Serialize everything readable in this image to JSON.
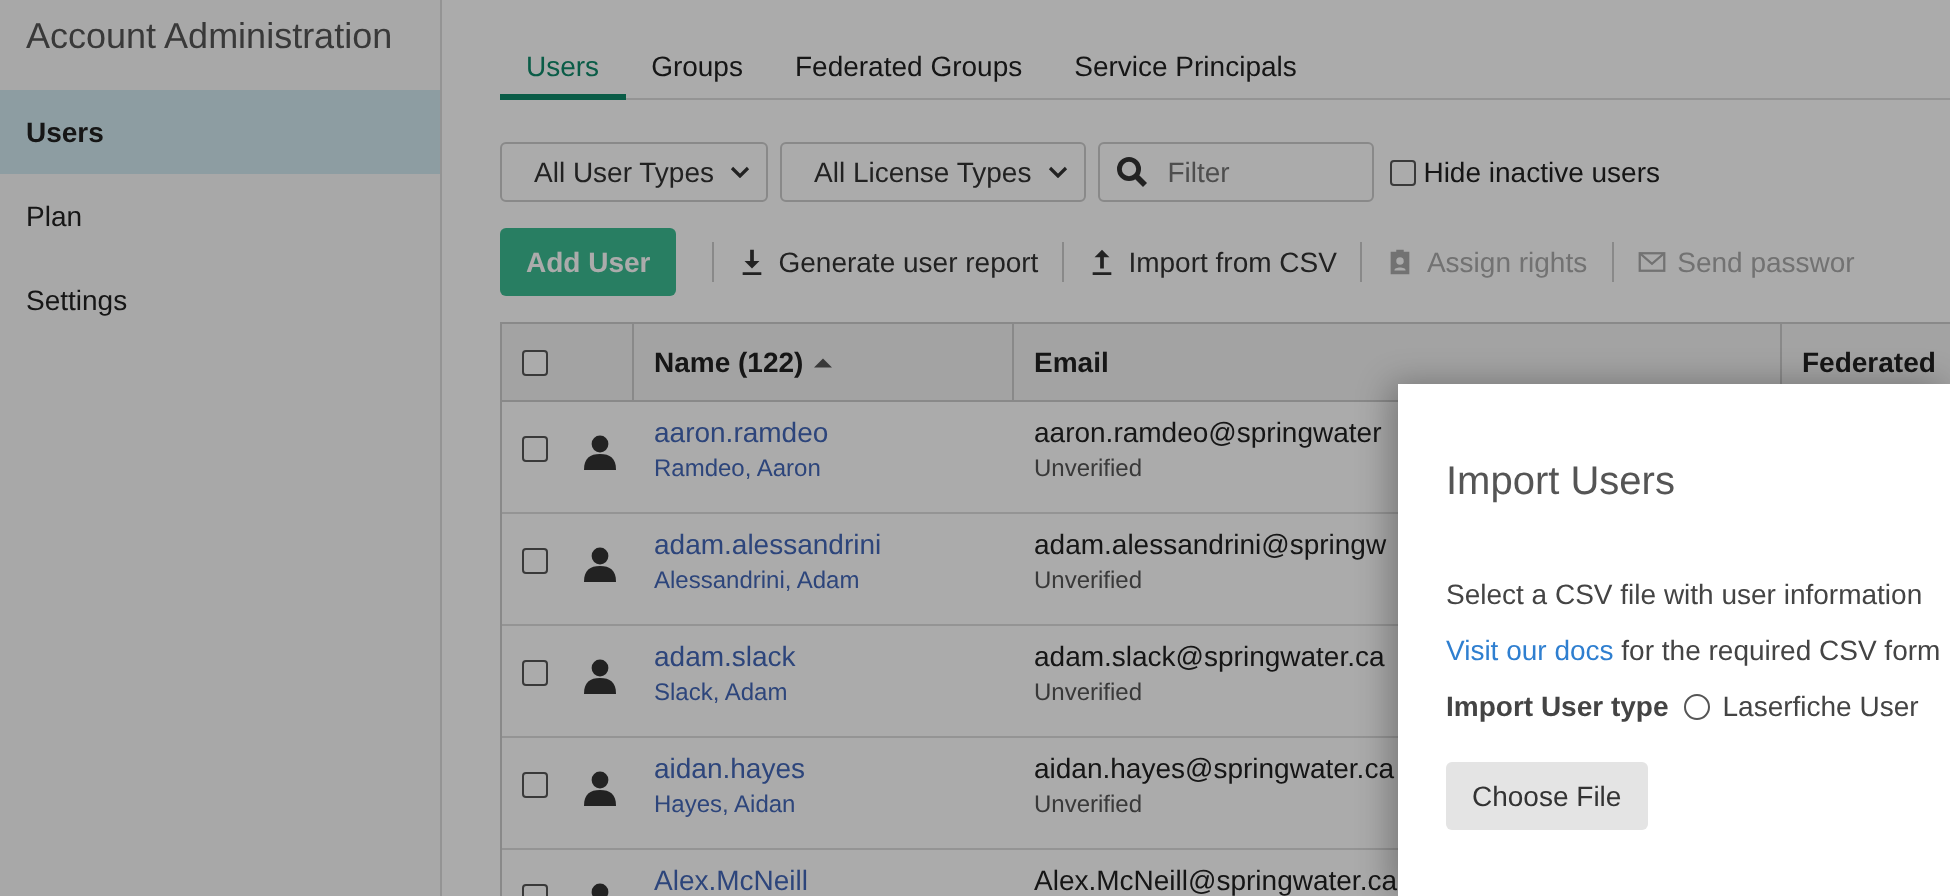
{
  "sidebar": {
    "title": "Account Administration",
    "items": [
      {
        "label": "Users",
        "selected": true
      },
      {
        "label": "Plan",
        "selected": false
      },
      {
        "label": "Settings",
        "selected": false
      }
    ]
  },
  "tabs": [
    {
      "label": "Users",
      "selected": true
    },
    {
      "label": "Groups",
      "selected": false
    },
    {
      "label": "Federated Groups",
      "selected": false
    },
    {
      "label": "Service Principals",
      "selected": false
    }
  ],
  "filters": {
    "user_type": "All User Types",
    "license_type": "All License Types",
    "search": {
      "placeholder": "Filter"
    },
    "hide_inactive": {
      "label": "Hide inactive users",
      "checked": false
    }
  },
  "toolbar": {
    "add_button": "Add User",
    "actions": [
      {
        "kind": "download",
        "label": "Generate user report",
        "disabled": false
      },
      {
        "kind": "upload",
        "label": "Import from CSV",
        "disabled": false
      },
      {
        "kind": "badge",
        "label": "Assign rights",
        "disabled": true
      },
      {
        "kind": "mail",
        "label": "Send passwor",
        "disabled": true
      }
    ]
  },
  "table": {
    "select_all": {
      "checked": false
    },
    "columns": [
      {
        "label": "Name (122)",
        "sorted": true
      },
      {
        "label": "Email",
        "sorted": false
      },
      {
        "label": "Federated",
        "sorted": false
      }
    ],
    "rows": [
      {
        "username": "aaron.ramdeo",
        "full_name": "Ramdeo, Aaron",
        "email": "aaron.ramdeo@springwater",
        "status": "Unverified",
        "checked": false
      },
      {
        "username": "adam.alessandrini",
        "full_name": "Alessandrini, Adam",
        "email": "adam.alessandrini@springw",
        "status": "Unverified",
        "checked": false
      },
      {
        "username": "adam.slack",
        "full_name": "Slack, Adam",
        "email": "adam.slack@springwater.ca",
        "status": "Unverified",
        "checked": false
      },
      {
        "username": "aidan.hayes",
        "full_name": "Hayes, Aidan",
        "email": "aidan.hayes@springwater.ca",
        "status": "Unverified",
        "checked": false
      },
      {
        "username": "Alex.McNeill",
        "email": "Alex.McNeill@springwater.ca",
        "checked": false
      }
    ]
  },
  "modal": {
    "title": "Import Users",
    "description": "Select a CSV file with user information",
    "docs_link": "Visit our docs",
    "docs_rest": "for the required CSV form",
    "type_label": "Import User type",
    "type_options": [
      {
        "label": "Laserfiche User",
        "selected": false
      }
    ],
    "choose_button": "Choose File"
  }
}
